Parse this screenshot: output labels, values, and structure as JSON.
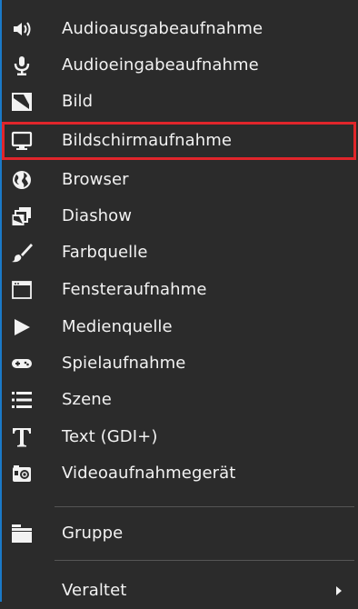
{
  "menu": {
    "items": [
      {
        "label": "Audioausgabeaufnahme",
        "icon": "speaker-icon"
      },
      {
        "label": "Audioeingabeaufnahme",
        "icon": "microphone-icon"
      },
      {
        "label": "Bild",
        "icon": "image-icon"
      },
      {
        "label": "Bildschirmaufnahme",
        "icon": "monitor-icon",
        "highlighted": true
      },
      {
        "label": "Browser",
        "icon": "globe-icon"
      },
      {
        "label": "Diashow",
        "icon": "slideshow-icon"
      },
      {
        "label": "Farbquelle",
        "icon": "brush-icon"
      },
      {
        "label": "Fensteraufnahme",
        "icon": "window-icon"
      },
      {
        "label": "Medienquelle",
        "icon": "play-icon"
      },
      {
        "label": "Spielaufnahme",
        "icon": "gamepad-icon"
      },
      {
        "label": "Szene",
        "icon": "list-icon"
      },
      {
        "label": "Text (GDI+)",
        "icon": "text-icon"
      },
      {
        "label": "Videoaufnahmegerät",
        "icon": "camera-icon"
      }
    ],
    "group": {
      "label": "Gruppe",
      "icon": "folder-icon"
    },
    "deprecated": {
      "label": "Veraltet",
      "icon": "submenu-arrow-icon"
    }
  },
  "colors": {
    "background": "#2b2b2b",
    "text": "#f2f2f2",
    "highlight_border": "#e0252b",
    "accent_edge": "#1a7ac8",
    "separator": "#555555"
  }
}
